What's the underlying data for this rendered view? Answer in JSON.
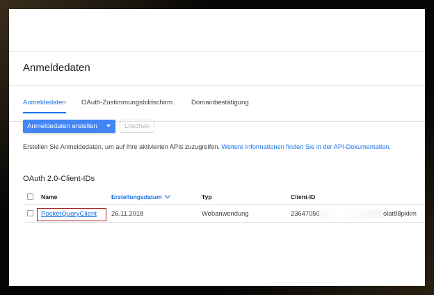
{
  "page": {
    "title": "Anmeldedaten"
  },
  "tabs": [
    {
      "label": "Anmeldedaten",
      "active": true
    },
    {
      "label": "OAuth-Zustimmungsbildschirm",
      "active": false
    },
    {
      "label": "Domainbestätigung",
      "active": false
    }
  ],
  "toolbar": {
    "create_label": "Anmeldedaten erstellen",
    "delete_label": "Löschen"
  },
  "info": {
    "text": "Erstellen Sie Anmeldedaten, um auf Ihre aktivierten APIs zuzugreifen.",
    "link": "Weitere Informationen finden Sie in der API-Dokumentation."
  },
  "section": {
    "title": "OAuth 2.0-Client-IDs"
  },
  "table": {
    "columns": [
      "Name",
      "Erstellungsdatum",
      "Typ",
      "Client-ID"
    ],
    "rows": [
      {
        "name": "PocketQueryClient",
        "date": "26.11.2018",
        "type": "Webanwendung",
        "client_id_start": "236470504€",
        "client_id_end": "olat88pkkm"
      }
    ]
  },
  "colors": {
    "accent": "#1a73e8",
    "button": "#4285f4",
    "highlight_border": "#9b1c1c"
  }
}
